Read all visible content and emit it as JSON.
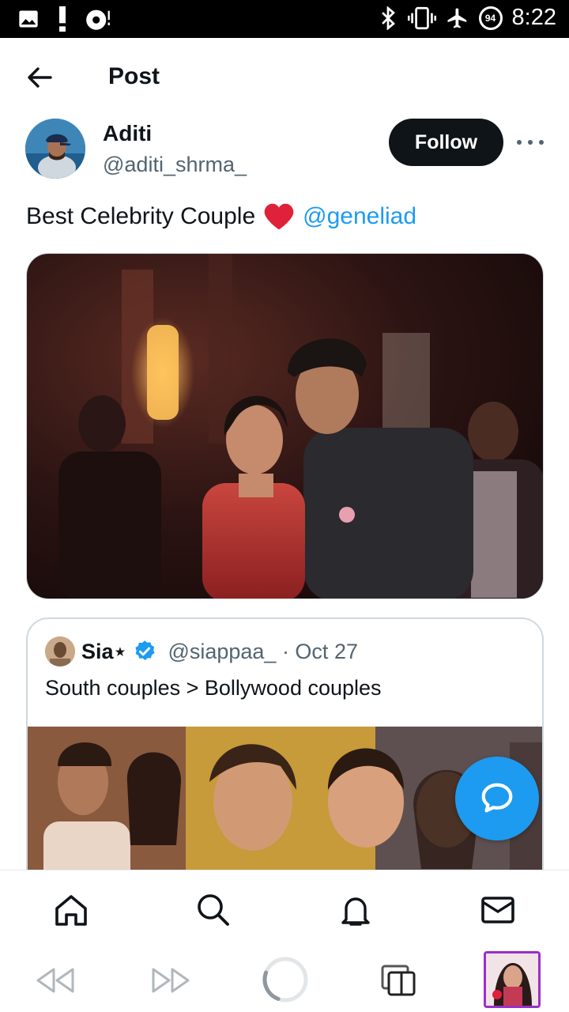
{
  "status_bar": {
    "time": "8:22",
    "battery": "94"
  },
  "header": {
    "title": "Post"
  },
  "author": {
    "name": "Aditi",
    "handle": "@aditi_shrma_",
    "follow_label": "Follow"
  },
  "post": {
    "text": "Best Celebrity Couple",
    "emoji": "❤️",
    "mention": "@geneliad"
  },
  "quote": {
    "name": "Sia⋆",
    "handle": "@siappaa_ · Oct 27",
    "text": "South couples > Bollywood couples"
  },
  "colors": {
    "accent": "#1d9bf0",
    "text": "#0f1419",
    "secondary": "#536471",
    "follow_bg": "#0f1419"
  },
  "icons": {
    "status_left": [
      "image-icon",
      "alert-icon",
      "media-disc-icon"
    ],
    "status_right": [
      "bluetooth-icon",
      "vibrate-icon",
      "airplane-icon",
      "battery-icon"
    ],
    "bottom_nav": [
      "home-icon",
      "search-icon",
      "notifications-icon",
      "messages-icon"
    ],
    "browser_bar": [
      "rewind-icon",
      "fast-forward-icon",
      "loading-icon",
      "tabs-icon",
      "thumbnail"
    ]
  }
}
